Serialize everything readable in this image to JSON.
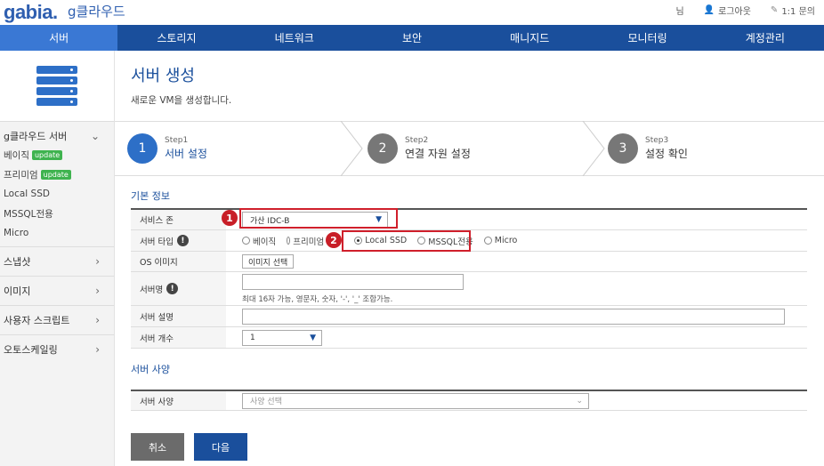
{
  "header": {
    "logo": "gabia.",
    "logo_sub": "g클라우드",
    "user_suffix": "님",
    "logout": "로그아웃",
    "inquiry": "1:1 문의"
  },
  "nav": {
    "items": [
      "서버",
      "스토리지",
      "네트워크",
      "보안",
      "매니지드",
      "모니터링",
      "계정관리"
    ],
    "active_index": 0
  },
  "sidebar": {
    "group_title": "g클라우드 서버",
    "sub_items": [
      {
        "label": "베이직",
        "badge": "update"
      },
      {
        "label": "프리미엄",
        "badge": "update"
      },
      {
        "label": "Local SSD",
        "badge": ""
      },
      {
        "label": "MSSQL전용",
        "badge": ""
      },
      {
        "label": "Micro",
        "badge": ""
      }
    ],
    "menus": [
      "스냅샷",
      "이미지",
      "사용자 스크립트",
      "오토스케일링"
    ]
  },
  "page": {
    "title": "서버 생성",
    "subtitle": "새로운 VM을 생성합니다."
  },
  "steps": [
    {
      "number": "1",
      "small": "Step1",
      "label": "서버 설정",
      "active": true
    },
    {
      "number": "2",
      "small": "Step2",
      "label": "연결 자원 설정",
      "active": false
    },
    {
      "number": "3",
      "small": "Step3",
      "label": "설정 확인",
      "active": false
    }
  ],
  "basic_info": {
    "section_title": "기본 정보",
    "zone_label": "서비스 존",
    "zone_value": "가산 IDC-B",
    "type_label": "서버 타입",
    "types": [
      "베이직",
      "프리미엄",
      "Local SSD",
      "MSSQL전용",
      "Micro"
    ],
    "type_selected": "Local SSD",
    "os_label": "OS 이미지",
    "os_button": "이미지 선택",
    "name_label": "서버명",
    "name_hint": "최대 16자 가능, 영문자, 숫자, '-', '_' 조합가능.",
    "desc_label": "서버 설명",
    "count_label": "서버 개수",
    "count_value": "1"
  },
  "spec": {
    "section_title": "서버 사양",
    "spec_label": "서버 사양",
    "spec_placeholder": "사양 선택"
  },
  "buttons": {
    "cancel": "취소",
    "next": "다음"
  },
  "annotations": [
    "1",
    "2"
  ],
  "colors": {
    "primary": "#1a4f9c",
    "nav_active": "#3a78d4",
    "highlight": "#d01f2b",
    "badge": "#3fb34f"
  }
}
